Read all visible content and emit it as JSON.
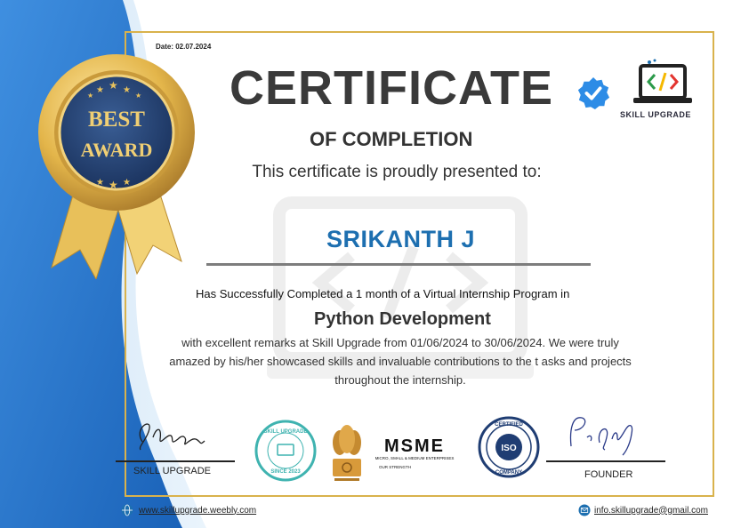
{
  "certificate": {
    "date": "Date: 02.07.2024",
    "title": "CERTIFICATE",
    "subtitle": "OF COMPLETION",
    "presented": "This certificate is proudly presented to:",
    "name": "SRIKANTH J",
    "completed_line": "Has Successfully Completed a 1 month of a Virtual Internship Program in",
    "program": "Python Development",
    "remarks": "with excellent remarks at Skill Upgrade from 01/06/2024 to 30/06/2024. We were truly amazed by his/her showcased skills and invaluable contributions  to the t asks and projects throughout the internship."
  },
  "badge": {
    "line1": "BEST",
    "line2": "AWARD"
  },
  "logo": {
    "text": "SKILL UPGRADE"
  },
  "seals": {
    "skill_top": "SKILL UPGRADE",
    "skill_bottom": "SINCE 2023",
    "msme_title": "MSME",
    "msme_sub": "MICRO, SMALL & MEDIUM ENTERPRISES",
    "msme_tag": "OUR STRENGTH",
    "iso_top": "CERTIFIED",
    "iso_mid": "ISO",
    "iso_bottom": "COMPANY"
  },
  "signatures": {
    "left_label": "SKILL UPGRADE",
    "right_label": "FOUNDER"
  },
  "footer": {
    "website": "www.skillupgrade.weebly.com",
    "email": "info.skillupgrade@gmail.com"
  },
  "colors": {
    "blue": "#1d6fb0",
    "gold": "#d9b24c",
    "title": "#3a3a3a",
    "navy": "#1f3d73"
  },
  "icons": {
    "verified": "verified-check-icon",
    "web": "globe-icon",
    "mail": "mail-icon"
  }
}
